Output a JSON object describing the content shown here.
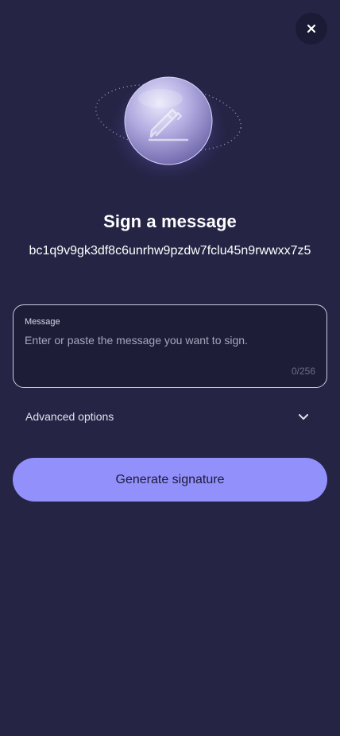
{
  "header": {
    "close_icon": "close-icon"
  },
  "hero": {
    "icon": "sign-pen-icon"
  },
  "title": "Sign a message",
  "address": "bc1q9v9gk3df8c6unrhw9pzdw7fclu45n9rwwxx7z5",
  "message": {
    "label": "Message",
    "placeholder": "Enter or paste the message you want to sign.",
    "value": "",
    "counter": "0/256"
  },
  "advanced": {
    "label": "Advanced options",
    "icon": "chevron-down-icon"
  },
  "actions": {
    "generate_label": "Generate signature"
  },
  "colors": {
    "background": "#252445",
    "accent": "#9290fa",
    "surface": "#1e1d37"
  }
}
